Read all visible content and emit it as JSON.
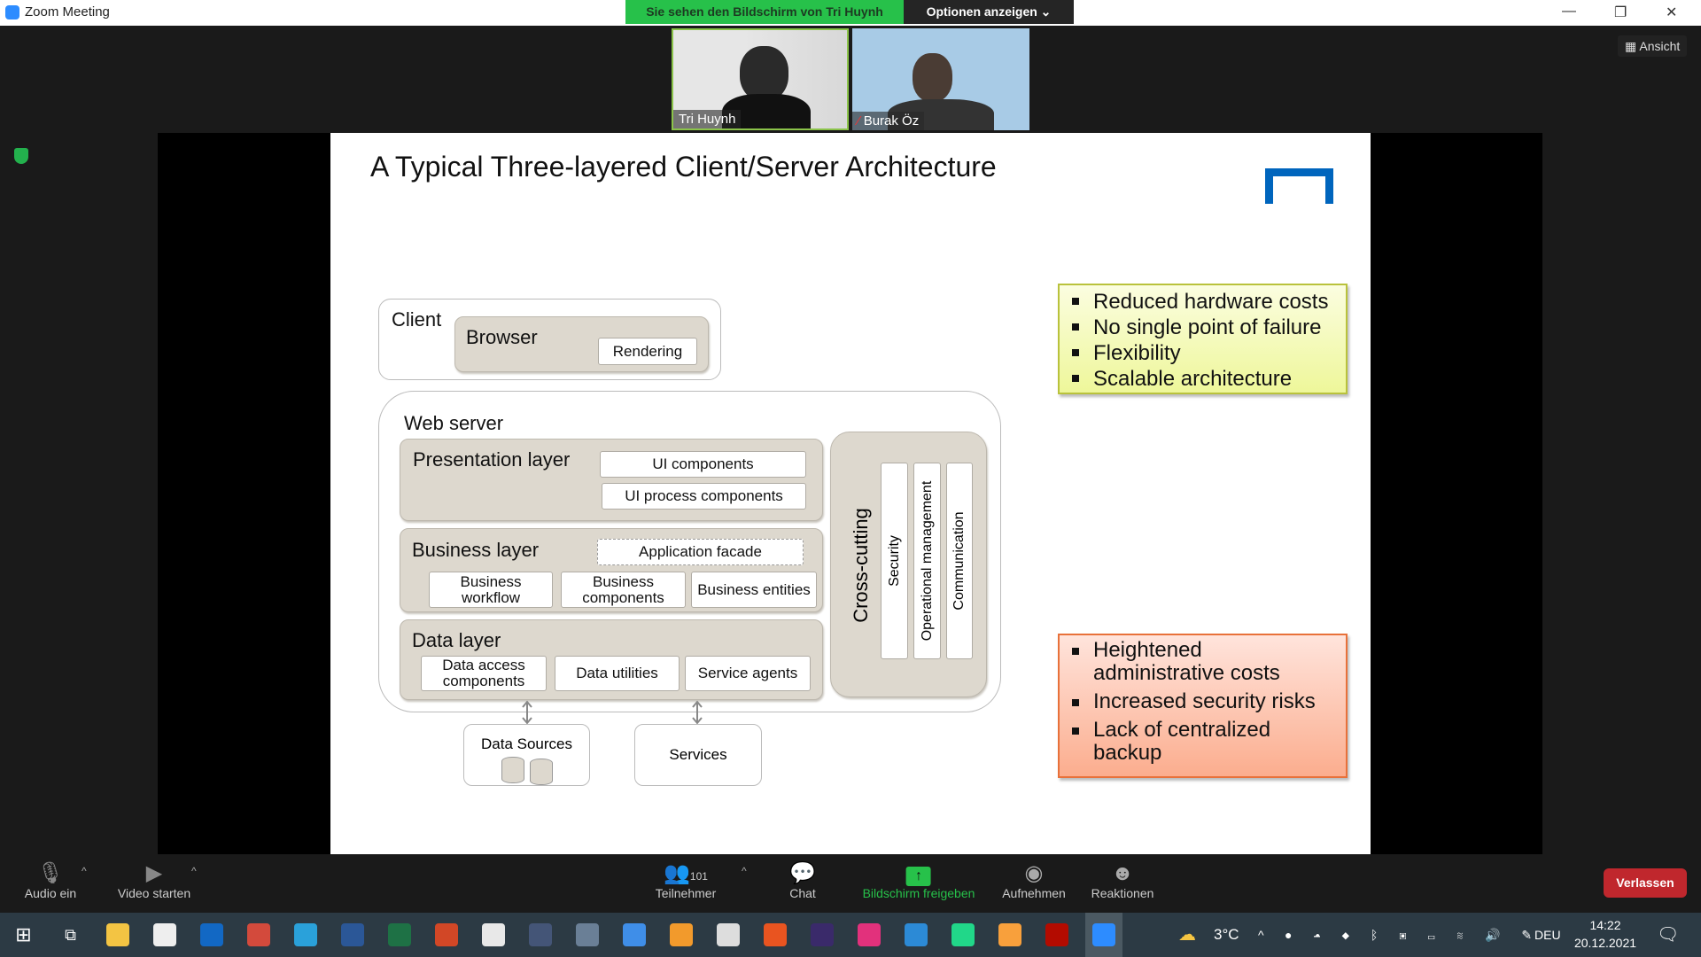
{
  "window": {
    "title": "Zoom Meeting",
    "banner": "Sie sehen den Bildschirm von Tri Huynh",
    "options": "Optionen anzeigen ⌄",
    "view_button": "Ansicht"
  },
  "participants": [
    {
      "name": "Tri Huynh"
    },
    {
      "name": "Burak Öz",
      "muted": true
    }
  ],
  "slide": {
    "title": "A Typical Three-layered Client/Server Architecture",
    "logo": "TUM",
    "client": "Client",
    "browser": "Browser",
    "rendering": "Rendering",
    "web_server": "Web server",
    "presentation": "Presentation layer",
    "ui_components": "UI components",
    "ui_process": "UI process components",
    "business": "Business layer",
    "app_facade": "Application facade",
    "business_workflow": "Business workflow",
    "business_components": "Business components",
    "business_entities": "Business entities",
    "data": "Data layer",
    "data_access": "Data access components",
    "data_utilities": "Data utilities",
    "service_agents": "Service agents",
    "cross_cutting": "Cross-cutting",
    "security": "Security",
    "operational": "Operational management",
    "communication": "Communication",
    "data_sources": "Data Sources",
    "services": "Services",
    "pros": [
      "Reduced hardware costs",
      "No single point of failure",
      "Flexibility",
      "Scalable architecture"
    ],
    "cons": [
      "Heightened administrative costs",
      "Increased security risks",
      "Lack of centralized backup"
    ]
  },
  "toolbar": {
    "audio": "Audio ein",
    "video": "Video starten",
    "participants": "Teilnehmer",
    "participant_count": "101",
    "chat": "Chat",
    "share": "Bildschirm freigeben",
    "record": "Aufnehmen",
    "reactions": "Reaktionen",
    "leave": "Verlassen"
  },
  "taskbar": {
    "weather": "3°C",
    "lang": "DEU",
    "time": "14:22",
    "date": "20.12.2021",
    "apps": [
      {
        "name": "file-explorer",
        "color": "#f3c443"
      },
      {
        "name": "store",
        "color": "#eeeeee"
      },
      {
        "name": "outlook",
        "color": "#1268c4"
      },
      {
        "name": "chrome",
        "color": "#d34a3c"
      },
      {
        "name": "telegram",
        "color": "#2aa1da"
      },
      {
        "name": "word",
        "color": "#2b5797"
      },
      {
        "name": "excel",
        "color": "#1e7145"
      },
      {
        "name": "powerpoint",
        "color": "#d24726"
      },
      {
        "name": "snipping",
        "color": "#e8e8e8"
      },
      {
        "name": "keepass",
        "color": "#445577"
      },
      {
        "name": "calculator",
        "color": "#6a7f96"
      },
      {
        "name": "todo",
        "color": "#3f8ee8"
      },
      {
        "name": "sublime",
        "color": "#f29a2c"
      },
      {
        "name": "inkscape",
        "color": "#dddddd"
      },
      {
        "name": "ubuntu",
        "color": "#e95420"
      },
      {
        "name": "texstudio",
        "color": "#3a2a6a"
      },
      {
        "name": "intellij",
        "color": "#e2317c"
      },
      {
        "name": "vscode",
        "color": "#2c8ad6"
      },
      {
        "name": "pycharm",
        "color": "#21d789"
      },
      {
        "name": "media-player",
        "color": "#f8a03c"
      },
      {
        "name": "acrobat",
        "color": "#b30b00"
      },
      {
        "name": "zoom",
        "color": "#2d8cff"
      }
    ]
  }
}
